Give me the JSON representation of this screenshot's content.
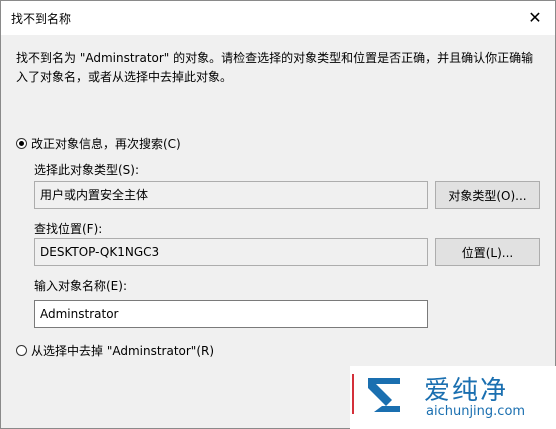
{
  "window": {
    "title": "找不到名称",
    "close_glyph": "✕"
  },
  "message": {
    "line1": "找不到名为 \"Adminstrator\" 的对象。请检查选择的对象类型和位置是否正确，并且确认你正确输",
    "line2": "入了对象名，或者从选择中去掉此对象。"
  },
  "options": {
    "correct": {
      "label": "改正对象信息，再次搜索(C)",
      "selected": true
    },
    "remove": {
      "label": "从选择中去掉 \"Adminstrator\"(R)",
      "selected": false
    }
  },
  "object_type": {
    "label": "选择此对象类型(S):",
    "value": "用户或内置安全主体",
    "button": "对象类型(O)..."
  },
  "location": {
    "label": "查找位置(F):",
    "value": "DESKTOP-QK1NGC3",
    "button": "位置(L)..."
  },
  "object_name": {
    "label": "输入对象名称(E):",
    "value": "Adminstrator"
  },
  "watermark": {
    "title": "爱纯净",
    "url": "aichunjing.com",
    "colors": {
      "blue": "#1a6fb0",
      "red": "#d4303a"
    }
  }
}
